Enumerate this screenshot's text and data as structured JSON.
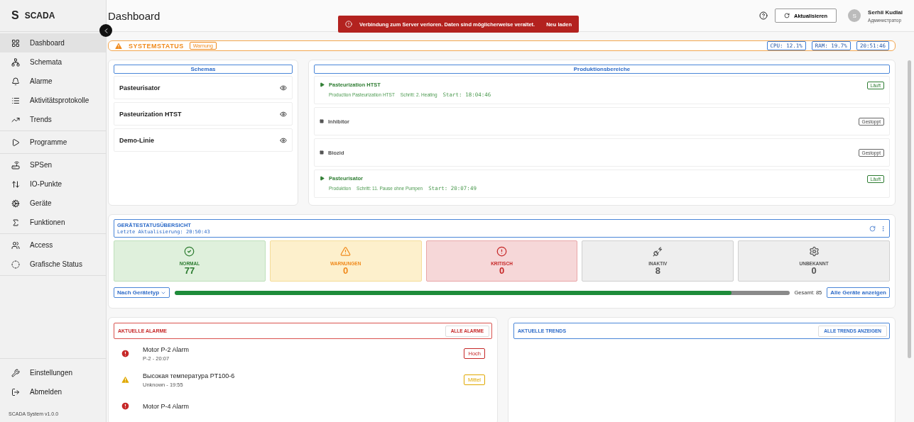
{
  "brand": {
    "logo": "S",
    "name": "SCADA"
  },
  "sidebar": {
    "groups": [
      [
        {
          "label": "Dashboard",
          "selected": true
        },
        {
          "label": "Schemata",
          "selected": false
        },
        {
          "label": "Alarme",
          "selected": false
        },
        {
          "label": "Aktivitätsprotokolle",
          "selected": false
        },
        {
          "label": "Trends",
          "selected": false
        }
      ],
      [
        {
          "label": "Programme",
          "selected": false
        }
      ],
      [
        {
          "label": "SPSen",
          "selected": false
        },
        {
          "label": "IO-Punkte",
          "selected": false
        },
        {
          "label": "Geräte",
          "selected": false
        },
        {
          "label": "Funktionen",
          "selected": false
        }
      ],
      [
        {
          "label": "Access",
          "selected": false
        },
        {
          "label": "Grafische Status",
          "selected": false
        }
      ]
    ],
    "bottom": [
      {
        "label": "Einstellungen"
      },
      {
        "label": "Abmelden"
      }
    ],
    "version": "SCADA System v1.0.0"
  },
  "header": {
    "title": "Dashboard",
    "refresh": "Aktualisieren",
    "user": {
      "initial": "S",
      "name": "Serhii Kudlai",
      "role": "Администратор"
    }
  },
  "toast": {
    "message": "Verbindung zum Server verloren. Daten sind möglicherweise veraltet.",
    "action": "Neu laden"
  },
  "system_status": {
    "title": "SYSTEMSTATUS",
    "badge": "Warnung",
    "chips": [
      "CPU: 12.1%",
      "RAM: 19.7%",
      "20:51:46"
    ]
  },
  "schemas": {
    "title": "Schemas",
    "items": [
      "Pasteurisator",
      "Pasteurization HTST",
      "Demo-Linie"
    ]
  },
  "production": {
    "title": "Produktionsbereiche",
    "items": [
      {
        "name": "Pasteurization HTST",
        "running": true,
        "status": "Läuft",
        "details": [
          "Production Pasteurization HTST",
          "Schritt: 2. Heating"
        ],
        "start": "Start: 18:04:46"
      },
      {
        "name": "Inhibitor",
        "running": false,
        "status": "Gestoppt"
      },
      {
        "name": "Biozid",
        "running": false,
        "status": "Gestoppt"
      },
      {
        "name": "Pasteurisator",
        "running": true,
        "status": "Läuft",
        "details": [
          "Produktion",
          "Schritt: 11. Pause ohne Pumpen"
        ],
        "start": "Start: 20:07:49"
      }
    ]
  },
  "devices": {
    "title": "GERÄTESTATUSÜBERSICHT",
    "updated": "Letzte Aktualisierung: 20:50:43",
    "cards": [
      {
        "kind": "normal",
        "label": "NORMAL",
        "count": "77"
      },
      {
        "kind": "warning",
        "label": "WARNUNGEN",
        "count": "0"
      },
      {
        "kind": "critical",
        "label": "KRITISCH",
        "count": "0"
      },
      {
        "kind": "inactive",
        "label": "INAKTIV",
        "count": "8"
      },
      {
        "kind": "unknown",
        "label": "UNBEKANNT",
        "count": "0"
      }
    ],
    "filter": "Nach Gerätetyp",
    "level": 0.906,
    "total": "Gesamt: 85",
    "all_button": "Alle Geräte anzeigen"
  },
  "alarms": {
    "title": "AKTUELLE ALARME",
    "button": "ALLE ALARME",
    "items": [
      {
        "kind": "high",
        "title": "Motor P-2 Alarm",
        "meta": "P-2 - 20:07",
        "badge": "Hoch"
      },
      {
        "kind": "medium",
        "title": "Высокая температура PT100-6",
        "meta": "Unknown - 19:55",
        "badge": "Mittel"
      },
      {
        "kind": "high",
        "title": "Motor P-4 Alarm"
      }
    ]
  },
  "trends": {
    "title": "AKTUELLE TRENDS",
    "button": "ALLE TRENDS ANZEIGEN"
  }
}
